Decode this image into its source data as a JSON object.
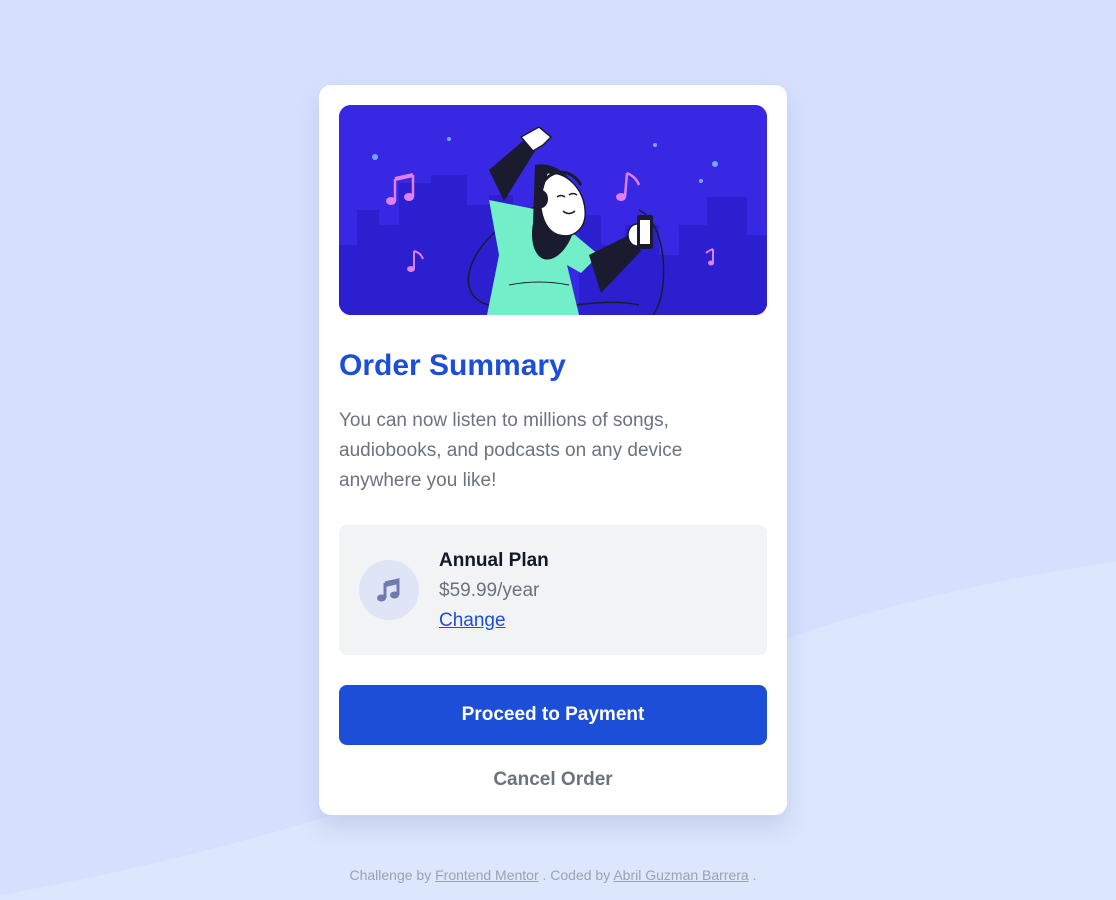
{
  "summary": {
    "title": "Order Summary",
    "description": "You can now listen to millions of songs, audiobooks, and podcasts on any device anywhere you like!"
  },
  "plan": {
    "icon": "music-note-icon",
    "name": "Annual Plan",
    "price": "$59.99/year",
    "change_label": "Change"
  },
  "actions": {
    "proceed_label": "Proceed to Payment",
    "cancel_label": "Cancel Order"
  },
  "footer": {
    "challenge_prefix": "Challenge by",
    "challenge_link": "Frontend Mentor",
    "coded_prefix": ". Coded by",
    "coded_link": "Abril Guzman Barrera",
    "suffix": "."
  },
  "colors": {
    "background": "#d6e0fe",
    "wave": "#dce6fd",
    "accent": "#1d4ed8",
    "hero_bg": "#3828e3",
    "hero_buildings": "#2b1fcf",
    "note_pink": "#e27fee",
    "shirt": "#72efc9",
    "plan_bg": "#f2f3f5",
    "icon_circle": "#dfe4f7"
  }
}
